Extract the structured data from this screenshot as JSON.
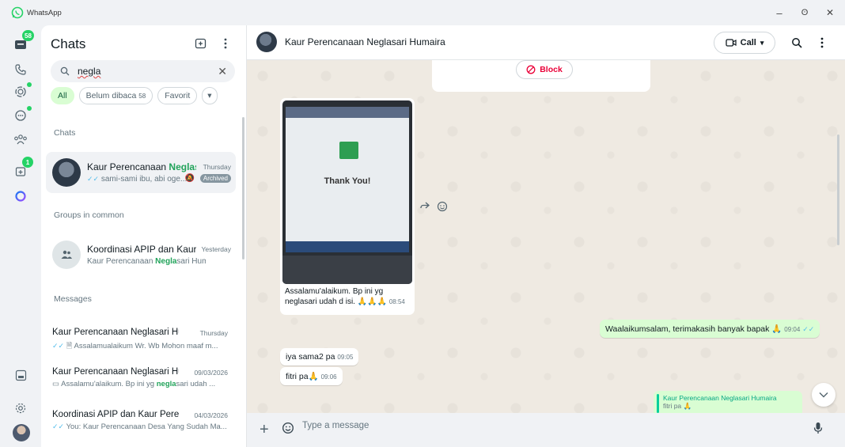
{
  "app": {
    "title": "WhatsApp"
  },
  "window": {
    "minimize": "–",
    "maximize": "ʘ",
    "close": "✕"
  },
  "rail": {
    "chats_badge": "58",
    "communities_badge": "1"
  },
  "panel": {
    "title": "Chats",
    "search_value": "negla",
    "filters": [
      {
        "label": "All"
      },
      {
        "label": "Belum dibaca",
        "count": "58"
      },
      {
        "label": "Favorit"
      }
    ],
    "sections": {
      "chats": "Chats",
      "groups": "Groups in common",
      "messages": "Messages"
    },
    "chat_row": {
      "name_pre": "Kaur Perencanaan ",
      "name_hl": "Neglas...",
      "time": "Thursday",
      "preview": "sami-sami ibu, abi oge...",
      "archived": "Archived"
    },
    "group_row": {
      "name": "Koordinasi APIP dan Kaur ...",
      "time": "Yesterday",
      "preview_pre": "Kaur Perencanaan ",
      "preview_hl": "Negla",
      "preview_post": "sari Humaira ..."
    },
    "messages": [
      {
        "name": "Kaur Perencanaan Neglasari Humaira",
        "time": "Thursday",
        "preview": "Assalamualaikum Wr. Wb Mohon maaf m..."
      },
      {
        "name": "Kaur Perencanaan Neglasari Huma",
        "time": "09/03/2026",
        "preview_pre": "Assalamu'alaikum. Bp ini yg ",
        "preview_hl": "negla",
        "preview_post": "sari udah ..."
      },
      {
        "name": "Koordinasi APIP dan Kaur Peren...",
        "time": "04/03/2026",
        "preview": "You: Kaur Perencanaan Desa Yang Sudah Ma..."
      }
    ]
  },
  "conversation": {
    "title": "Kaur Perencanaan Neglasari Humaira",
    "call_label": "Call",
    "block_label": "Block",
    "image_message": {
      "screen_text": "Thank You!",
      "caption": "Assalamu'alaikum. Bp ini yg neglasari udah d isi. 🙏🙏🙏",
      "time": "08:54"
    },
    "messages": [
      {
        "text": "Waalaikumsalam, terimakasih banyak bapak 🙏",
        "time": "09:04"
      },
      {
        "text": "iya sama2 pa",
        "time": "09:05"
      },
      {
        "text": "fitri pa🙏",
        "time": "09:06"
      }
    ],
    "quote": {
      "name": "Kaur Perencanaan Neglasari Humaira",
      "text": "fitri pa 🙏"
    },
    "composer_placeholder": "Type a message"
  },
  "colors": {
    "accent": "#25d366",
    "outgoing": "#d9fdd3",
    "block": "#ea0038"
  }
}
